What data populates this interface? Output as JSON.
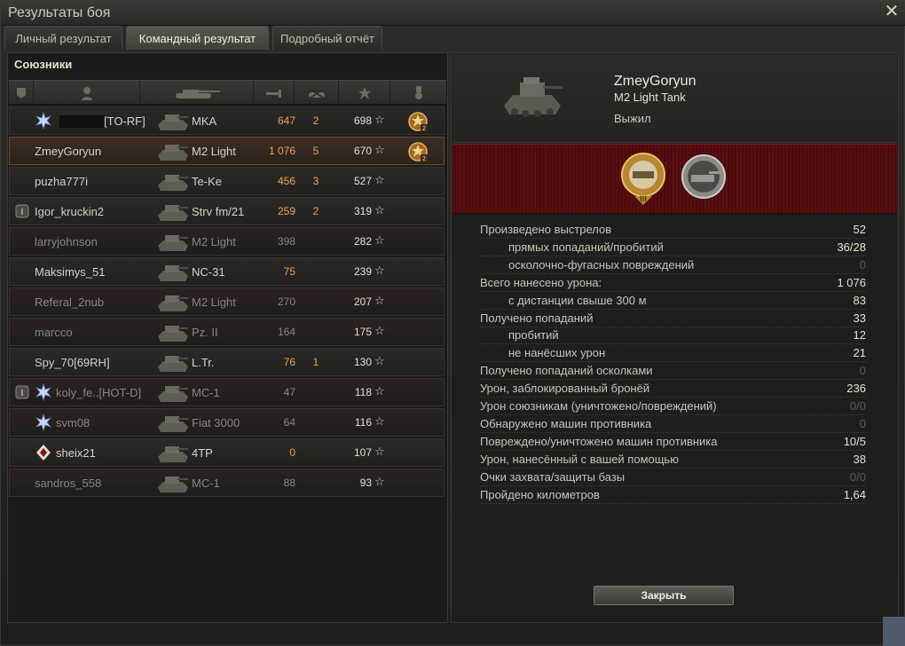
{
  "window": {
    "title": "Результаты боя",
    "close_glyph": "✕"
  },
  "tabs": [
    {
      "label": "Личный результат"
    },
    {
      "label": "Командный результат",
      "active": true
    },
    {
      "label": "Подробный отчёт"
    }
  ],
  "allies": {
    "heading": "Союзники",
    "columns": [
      "platoon-icon",
      "player-icon",
      "tank-icon",
      "damage-icon",
      "kills-icon",
      "xp-star-icon",
      "medal-icon"
    ],
    "rows": [
      {
        "name": "[TO-RF]",
        "vehicle": "MKA",
        "damage": "647",
        "kills": "2",
        "xp": "698",
        "dead": false,
        "self": false,
        "badge": "star-badge",
        "medal": true,
        "masked": true
      },
      {
        "name": "ZmeyGoryun",
        "vehicle": "M2 Light",
        "damage": "1 076",
        "kills": "5",
        "xp": "670",
        "dead": false,
        "self": true,
        "medal": true
      },
      {
        "name": "puzha777i",
        "vehicle": "Te-Ke",
        "damage": "456",
        "kills": "3",
        "xp": "527",
        "dead": false,
        "self": false
      },
      {
        "name": "Igor_kruckin2",
        "vehicle": "Strv fm/21",
        "damage": "259",
        "kills": "2",
        "xp": "319",
        "dead": false,
        "self": false,
        "platoon": true
      },
      {
        "name": "larryjohnson",
        "vehicle": "M2 Light",
        "damage": "398",
        "kills": "",
        "xp": "282",
        "dead": true,
        "self": false
      },
      {
        "name": "Maksimys_51",
        "vehicle": "NC-31",
        "damage": "75",
        "kills": "",
        "xp": "239",
        "dead": false,
        "self": false
      },
      {
        "name": "Referal_2nub",
        "vehicle": "M2 Light",
        "damage": "270",
        "kills": "",
        "xp": "207",
        "dead": true,
        "self": false
      },
      {
        "name": "marcco",
        "vehicle": "Pz. II",
        "damage": "164",
        "kills": "",
        "xp": "175",
        "dead": true,
        "self": false
      },
      {
        "name": "Spy_70[69RH]",
        "vehicle": "L.Tr.",
        "damage": "76",
        "kills": "1",
        "xp": "130",
        "dead": false,
        "self": false
      },
      {
        "name": "koly_fe..[HOT-D]",
        "vehicle": "MC-1",
        "damage": "47",
        "kills": "",
        "xp": "118",
        "dead": true,
        "self": false,
        "platoon": true,
        "badge": "star-badge"
      },
      {
        "name": "svm08",
        "vehicle": "Fiat 3000",
        "damage": "64",
        "kills": "",
        "xp": "116",
        "dead": true,
        "self": false,
        "badge": "star-badge"
      },
      {
        "name": "sheix21",
        "vehicle": "4TP",
        "damage": "0",
        "kills": "",
        "xp": "107",
        "dead": false,
        "self": false,
        "badge": "diamond-badge"
      },
      {
        "name": "sandros_558",
        "vehicle": "MC-1",
        "damage": "88",
        "kills": "",
        "xp": "93",
        "dead": true,
        "self": false
      }
    ]
  },
  "details": {
    "player": "ZmeyGoryun",
    "tank": "M2 Light Tank",
    "status": "Выжил",
    "stats": [
      {
        "label": "Произведено выстрелов",
        "value": "52",
        "indent": false
      },
      {
        "label": "прямых попаданий/пробитий",
        "value": "36/28",
        "indent": true
      },
      {
        "label": "осколочно-фугасных повреждений",
        "value": "0",
        "indent": true,
        "dim": true
      },
      {
        "label": "Всего нанесено урона:",
        "value": "1 076",
        "indent": false
      },
      {
        "label": "с дистанции свыше 300 м",
        "value": "83",
        "indent": true
      },
      {
        "label": "Получено попаданий",
        "value": "33",
        "indent": false
      },
      {
        "label": "пробитий",
        "value": "12",
        "indent": true
      },
      {
        "label": "не нанёсших урон",
        "value": "21",
        "indent": true
      },
      {
        "label": "Получено попаданий осколками",
        "value": "0",
        "indent": false,
        "dim": true
      },
      {
        "label": "Урон, заблокированный бронёй",
        "value": "236",
        "indent": false
      },
      {
        "label": "Урон союзникам (уничтожено/повреждений)",
        "value": "0/0",
        "indent": false,
        "dim": true
      },
      {
        "label": "Обнаружено машин противника",
        "value": "0",
        "indent": false,
        "dim": true
      },
      {
        "label": "Повреждено/уничтожено машин противника",
        "value": "10/5",
        "indent": false
      },
      {
        "label": "Урон, нанесённый с вашей помощью",
        "value": "38",
        "indent": false
      },
      {
        "label": "Очки захвата/защиты базы",
        "value": "0/0",
        "indent": false,
        "dim": true
      },
      {
        "label": "Пройдено километров",
        "value": "1,64",
        "indent": false
      }
    ],
    "close_label": "Закрыть"
  },
  "colors": {
    "accent": "#e8a64a",
    "dead_row": "#2a2221",
    "red_band": "#5a0e10"
  }
}
